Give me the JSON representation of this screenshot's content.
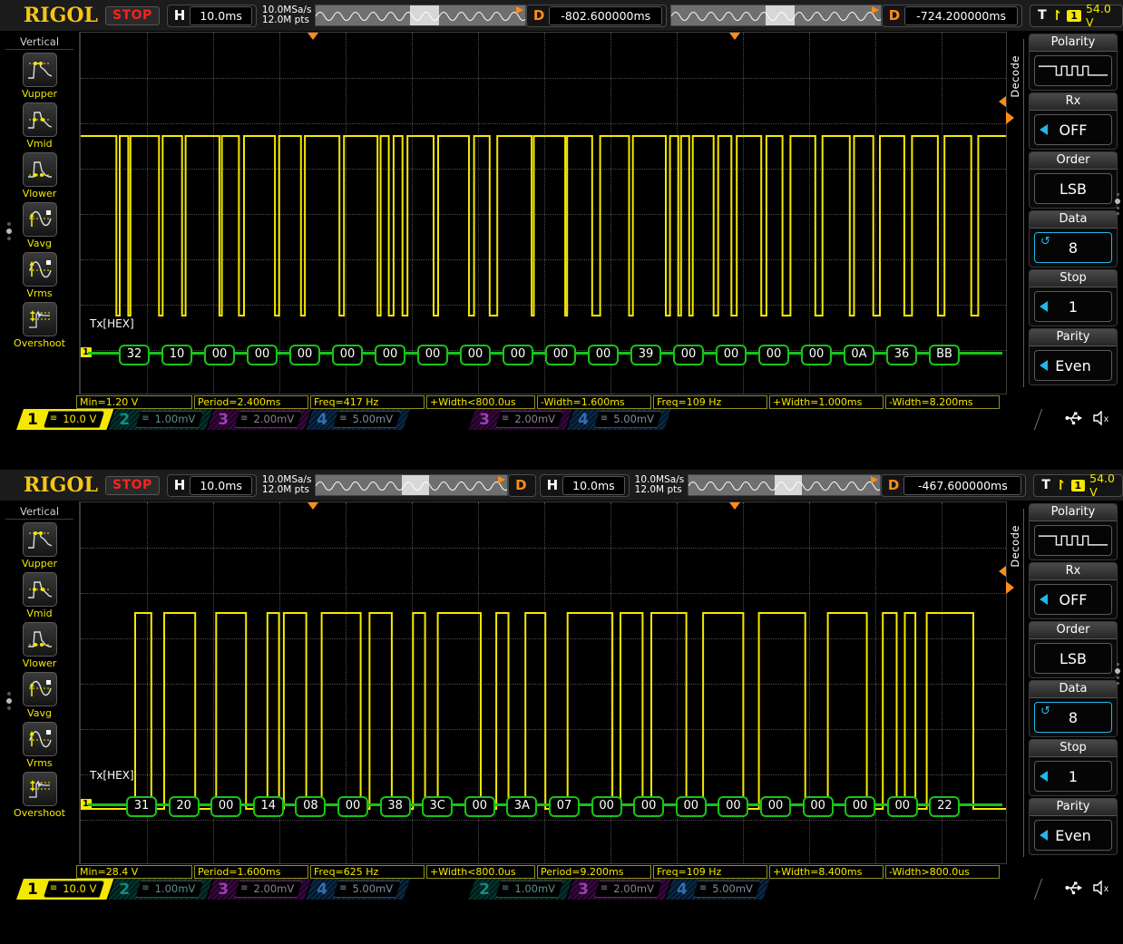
{
  "brand": "RIGOL",
  "scopes": [
    {
      "id": "scope-1",
      "toolbar": {
        "run_state": "STOP",
        "horiz_label": "H",
        "horiz_scale": "10.0ms",
        "sample_rate": "10.0MSa/s",
        "mem_depth": "12.0M pts",
        "delay_label_1": "D",
        "delay_value_1": "-802.600000ms",
        "delay_label_2": "D",
        "delay_value_2": "-724.200000ms",
        "trigger_t": "T",
        "trigger_channel": "1",
        "trigger_level": "54.0 V"
      },
      "left_menu": {
        "title": "Vertical",
        "items": [
          {
            "label": "Vupper",
            "icon": "vupper-icon"
          },
          {
            "label": "Vmid",
            "icon": "vmid-icon"
          },
          {
            "label": "Vlower",
            "icon": "vlower-icon"
          },
          {
            "label": "Vavg",
            "icon": "vavg-icon"
          },
          {
            "label": "Vrms",
            "icon": "vrms-icon"
          },
          {
            "label": "Overshoot",
            "icon": "overshoot-icon"
          }
        ]
      },
      "right_menu": {
        "tab_label": "Decode",
        "items": [
          {
            "title": "Polarity",
            "value": "",
            "icon": "polarity-waveform-icon",
            "kind": "icon"
          },
          {
            "title": "Rx",
            "value": "OFF",
            "kind": "arrow"
          },
          {
            "title": "Order",
            "value": "LSB",
            "kind": "plain"
          },
          {
            "title": "Data",
            "value": "8",
            "kind": "refresh",
            "selected": true
          },
          {
            "title": "Stop",
            "value": "1",
            "kind": "arrow"
          },
          {
            "title": "Parity",
            "value": "Even",
            "kind": "arrow"
          }
        ]
      },
      "decode": {
        "label": "Tx[HEX]",
        "bytes": [
          "32",
          "10",
          "00",
          "00",
          "00",
          "00",
          "00",
          "00",
          "00",
          "00",
          "00",
          "00",
          "39",
          "00",
          "00",
          "00",
          "00",
          "0A",
          "36",
          "BB"
        ]
      },
      "measurements": [
        "Min=1.20 V",
        "Period=2.400ms",
        "Freq=417 Hz",
        "+Width<800.0us",
        "-Width=1.600ms",
        "Freq=109 Hz",
        "+Width=1.000ms",
        "-Width=8.200ms"
      ],
      "channels": [
        {
          "num": "1",
          "scale": "10.0 V",
          "coupling": "dc"
        },
        {
          "num": "2",
          "scale": "1.00mV",
          "coupling": "dc"
        },
        {
          "num": "3",
          "scale": "2.00mV",
          "coupling": "dc"
        },
        {
          "num": "4",
          "scale": "5.00mV",
          "coupling": "dc"
        }
      ],
      "channels_right": [
        {
          "num": "3",
          "scale": "2.00mV",
          "coupling": "dc"
        },
        {
          "num": "4",
          "scale": "5.00mV",
          "coupling": "dc"
        }
      ],
      "sys_icons": [
        "usb-icon",
        "mute-icon"
      ]
    },
    {
      "id": "scope-2",
      "toolbar": {
        "run_state": "STOP",
        "horiz_label": "H",
        "horiz_scale": "10.0ms",
        "sample_rate": "10.0MSa/s",
        "mem_depth": "12.0M pts",
        "delay_label_1": "D",
        "horiz_label_2": "H",
        "horiz_scale_2": "10.0ms",
        "sample_rate_2": "10.0MSa/s",
        "mem_depth_2": "12.0M pts",
        "delay_label_2": "D",
        "delay_value_2": "-467.600000ms",
        "trigger_t": "T",
        "trigger_channel": "1",
        "trigger_level": "54.0 V"
      },
      "left_menu": {
        "title": "Vertical",
        "items": [
          {
            "label": "Vupper",
            "icon": "vupper-icon"
          },
          {
            "label": "Vmid",
            "icon": "vmid-icon"
          },
          {
            "label": "Vlower",
            "icon": "vlower-icon"
          },
          {
            "label": "Vavg",
            "icon": "vavg-icon"
          },
          {
            "label": "Vrms",
            "icon": "vrms-icon"
          },
          {
            "label": "Overshoot",
            "icon": "overshoot-icon"
          }
        ]
      },
      "right_menu": {
        "tab_label": "Decode",
        "items": [
          {
            "title": "Polarity",
            "value": "",
            "icon": "polarity-waveform-icon",
            "kind": "icon"
          },
          {
            "title": "Rx",
            "value": "OFF",
            "kind": "arrow"
          },
          {
            "title": "Order",
            "value": "LSB",
            "kind": "plain"
          },
          {
            "title": "Data",
            "value": "8",
            "kind": "refresh",
            "selected": true
          },
          {
            "title": "Stop",
            "value": "1",
            "kind": "arrow"
          },
          {
            "title": "Parity",
            "value": "Even",
            "kind": "arrow"
          }
        ]
      },
      "decode": {
        "label": "Tx[HEX]",
        "bytes": [
          "31",
          "20",
          "00",
          "14",
          "08",
          "00",
          "38",
          "3C",
          "00",
          "3A",
          "07",
          "00",
          "00",
          "00",
          "00",
          "00",
          "00",
          "00",
          "00",
          "22"
        ]
      },
      "measurements": [
        "Min=28.4 V",
        "Period=1.600ms",
        "Freq=625 Hz",
        "+Width<800.0us",
        "Period=9.200ms",
        "Freq=109 Hz",
        "+Width=8.400ms",
        "-Width>800.0us"
      ],
      "channels": [
        {
          "num": "1",
          "scale": "10.0 V",
          "coupling": "dc"
        },
        {
          "num": "2",
          "scale": "1.00mV",
          "coupling": "dc"
        },
        {
          "num": "3",
          "scale": "2.00mV",
          "coupling": "dc"
        },
        {
          "num": "4",
          "scale": "5.00mV",
          "coupling": "dc"
        }
      ],
      "channels_right": [
        {
          "num": "2",
          "scale": "1.00mV",
          "coupling": "dc"
        },
        {
          "num": "3",
          "scale": "2.00mV",
          "coupling": "dc"
        },
        {
          "num": "4",
          "scale": "5.00mV",
          "coupling": "dc"
        }
      ],
      "sys_icons": [
        "usb-icon",
        "mute-icon"
      ]
    }
  ],
  "colors": {
    "brand": "#f5c518",
    "channel1": "#f5e800",
    "decode": "#17c417",
    "accent": "#1fb8e8",
    "trigger": "#ff8c1a",
    "stop": "#ff2020"
  }
}
